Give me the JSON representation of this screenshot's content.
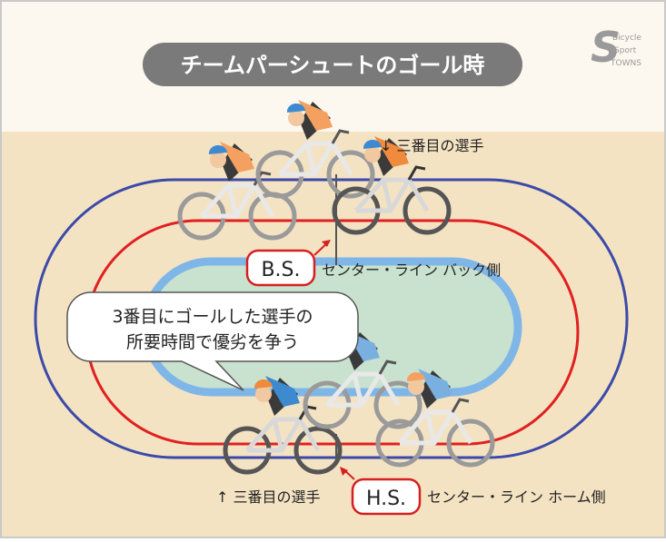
{
  "title": "チームパーシュートのゴール時",
  "logo": {
    "icon": "cycling-magazine-logo",
    "text_top": "Bicycle",
    "text_mid": "Sport",
    "text_bot": "TOWNS"
  },
  "annotations": {
    "third_rider_top": "↓ 三番目の選手",
    "third_rider_bottom": "↑ 三番目の選手",
    "bs_badge": "B.S.",
    "bs_label": "センター・ライン バック側",
    "hs_badge": "H.S.",
    "hs_label": "センター・ライン ホーム側"
  },
  "callout": {
    "line1": "3番目にゴールした選手の",
    "line2": "所要時間で優劣を争う"
  },
  "colors": {
    "background_top": "#fdf8ef",
    "background_track": "#f4e3c3",
    "outer_line": "#3b4aa8",
    "red_line": "#e02020",
    "inner_blue": "#7fb6e8",
    "infield": "#c9e2cf",
    "orange_team": "#f08a3c",
    "blue_team": "#3d8ad0",
    "badge_border": "#d62020"
  }
}
